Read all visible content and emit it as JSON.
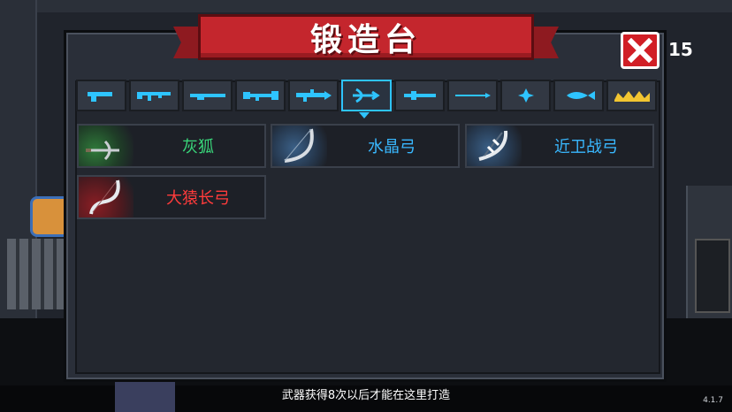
{
  "title": "锻造台",
  "gem_count": "15",
  "tabs": [
    {
      "icon": "pistol-icon",
      "active": false
    },
    {
      "icon": "assault-rifle-icon",
      "active": false
    },
    {
      "icon": "shotgun-icon",
      "active": false
    },
    {
      "icon": "rocket-launcher-icon",
      "active": false
    },
    {
      "icon": "laser-rifle-icon",
      "active": false
    },
    {
      "icon": "bow-icon",
      "active": true
    },
    {
      "icon": "staff-icon",
      "active": false
    },
    {
      "icon": "spear-icon",
      "active": false
    },
    {
      "icon": "shuriken-icon",
      "active": false
    },
    {
      "icon": "fish-icon",
      "active": false
    },
    {
      "icon": "crown-icon",
      "active": false
    }
  ],
  "weapons": [
    {
      "name": "灰狐",
      "rarity_color": "#39d67a"
    },
    {
      "name": "水晶弓",
      "rarity_color": "#39b8ff"
    },
    {
      "name": "近卫战弓",
      "rarity_color": "#39b8ff"
    },
    {
      "name": "大猿长弓",
      "rarity_color": "#ff3b3b"
    }
  ],
  "footer": "武器获得8次以后才能在这里打造",
  "version": "4.1.7",
  "colors": {
    "accent": "#2ec4ff",
    "banner": "#c4262d",
    "close": "#d11f26"
  }
}
